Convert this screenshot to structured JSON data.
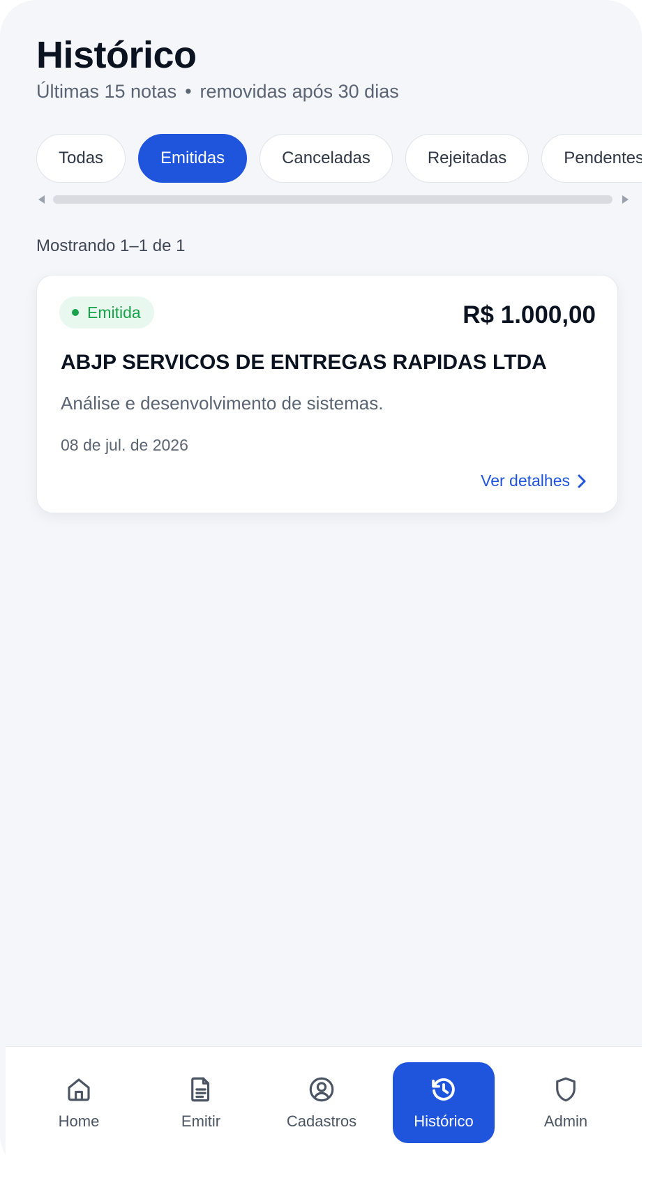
{
  "header": {
    "title": "Histórico",
    "subtitle_part1": "Últimas 15 notas",
    "subtitle_separator": "•",
    "subtitle_part2": "removidas após 30 dias"
  },
  "filters": {
    "chips": [
      "Todas",
      "Emitidas",
      "Canceladas",
      "Rejeitadas",
      "Pendentes"
    ],
    "active": "Emitidas"
  },
  "results": {
    "count_label": "Mostrando 1–1 de 1"
  },
  "invoices": [
    {
      "status": "Emitida",
      "amount": "R$ 1.000,00",
      "company": "ABJP SERVICOS DE ENTREGAS RAPIDAS LTDA",
      "description": "Análise e desenvolvimento de sistemas.",
      "date": "08 de jul. de 2026",
      "details_label": "Ver detalhes"
    }
  ],
  "nav": {
    "items": [
      {
        "label": "Home",
        "icon": "home-icon"
      },
      {
        "label": "Emitir",
        "icon": "document-icon"
      },
      {
        "label": "Cadastros",
        "icon": "user-circle-icon"
      },
      {
        "label": "Histórico",
        "icon": "history-icon"
      },
      {
        "label": "Admin",
        "icon": "shield-icon"
      }
    ],
    "active": "Histórico"
  },
  "colors": {
    "accent": "#1f54dd",
    "success": "#16a34a",
    "success_bg": "#e9f8ee",
    "background": "#f4f6fa"
  }
}
